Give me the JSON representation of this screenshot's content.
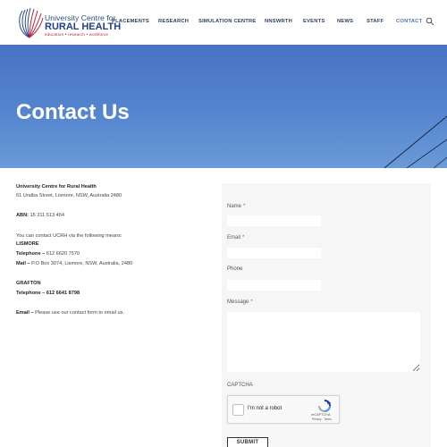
{
  "header": {
    "logo": {
      "line1": "University Centre for",
      "line2": "RURAL HEALTH",
      "line3": "education • research • workforce"
    },
    "nav": [
      {
        "label": "PLACEMENTS",
        "name": "nav-placements"
      },
      {
        "label": "RESEARCH",
        "name": "nav-research"
      },
      {
        "label": "SIMULATION CENTRE",
        "name": "nav-simulation-centre"
      },
      {
        "label": "NNSWRTH",
        "name": "nav-nnswrth"
      },
      {
        "label": "EVENTS",
        "name": "nav-events"
      },
      {
        "label": "NEWS",
        "name": "nav-news"
      },
      {
        "label": "STAFF",
        "name": "nav-staff"
      },
      {
        "label": "CONTACT",
        "name": "nav-contact",
        "active": true
      }
    ],
    "search_icon": "search-icon"
  },
  "hero": {
    "title": "Contact Us",
    "background_color": "#5585cf"
  },
  "info": {
    "org_name": "University Centre for Rural Health",
    "address": "61 Uralba Street, Lismore, NSW, Australia 2480",
    "abn_label": "ABN:",
    "abn_value": "15 211 513 464",
    "intro": "You can contact UCRH via the following means:",
    "lismore_heading": "LISMORE",
    "lismore_tel_label": "Telephone –",
    "lismore_tel_value": "612 6620 7570",
    "lismore_mail_label": "Mail –",
    "lismore_mail_value": "P.O Box 3074, Lismore, NSW, Australia, 2480",
    "grafton_heading": "GRAFTON",
    "grafton_tel_label": "Telephone –",
    "grafton_tel_value": "612 6641 8798",
    "email_label": "Email –",
    "email_value": "Please use our contact form to email us."
  },
  "form": {
    "name_label": "Name",
    "email_label": "Email",
    "phone_label": "Phone",
    "message_label": "Message",
    "required_mark": "*",
    "captcha_label": "CAPTCHA",
    "recaptcha_text": "I'm not a robot",
    "recaptcha_brand": "reCAPTCHA",
    "recaptcha_links": "Privacy - Terms",
    "submit_label": "SUBMIT"
  },
  "colors": {
    "nav_text": "#2f3f5f",
    "nav_active": "#4a76b6",
    "logo_blue": "#223f86",
    "logo_red": "#c0203a"
  }
}
